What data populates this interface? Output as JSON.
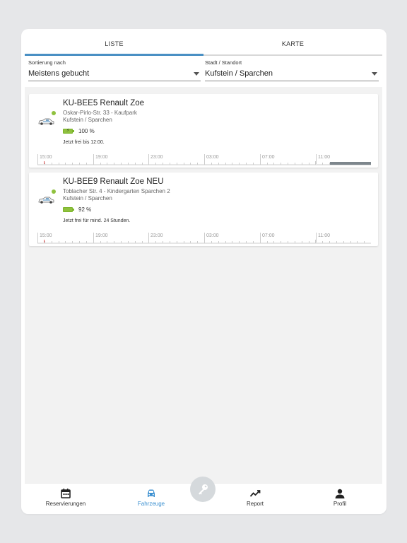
{
  "tabs": [
    {
      "label": "LISTE",
      "active": true
    },
    {
      "label": "KARTE",
      "active": false
    }
  ],
  "filters": {
    "sort": {
      "label": "Sortierung nach",
      "value": "Meistens gebucht"
    },
    "city": {
      "label": "Stadt / Standort",
      "value": "Kufstein / Sparchen"
    }
  },
  "vehicles": [
    {
      "title": "KU-BEE5 Renault Zoe",
      "address": "Oskar-Pirlo-Str. 33 - Kaufpark",
      "city": "Kufstein / Sparchen",
      "battery_percent": "100 %",
      "battery_level": 1.0,
      "charging": true,
      "availability": "Jetzt frei bis 12:00.",
      "status_color": "#8fc13e"
    },
    {
      "title": "KU-BEE9 Renault Zoe NEU",
      "address": "Toblacher Str. 4 - Kindergarten Sparchen 2",
      "city": "Kufstein / Sparchen",
      "battery_percent": "92 %",
      "battery_level": 0.92,
      "charging": false,
      "availability": "Jetzt frei für mind. 24 Stunden.",
      "status_color": "#8fc13e"
    }
  ],
  "timeline_labels": [
    "15:00",
    "19:00",
    "23:00",
    "03:00",
    "07:00",
    "11:00"
  ],
  "bottom_nav": [
    {
      "label": "Reservierungen",
      "icon": "calendar-icon",
      "active": false
    },
    {
      "label": "Fahrzeuge",
      "icon": "car-icon",
      "active": true
    },
    {
      "label": "Report",
      "icon": "chart-line-icon",
      "active": false
    },
    {
      "label": "Profil",
      "icon": "person-icon",
      "active": false
    }
  ],
  "fab": {
    "icon": "key-icon"
  },
  "colors": {
    "accent": "#4a90c4",
    "active_nav": "#3a8fd0",
    "battery": "#8fc13e",
    "booked": "#7d868c"
  }
}
